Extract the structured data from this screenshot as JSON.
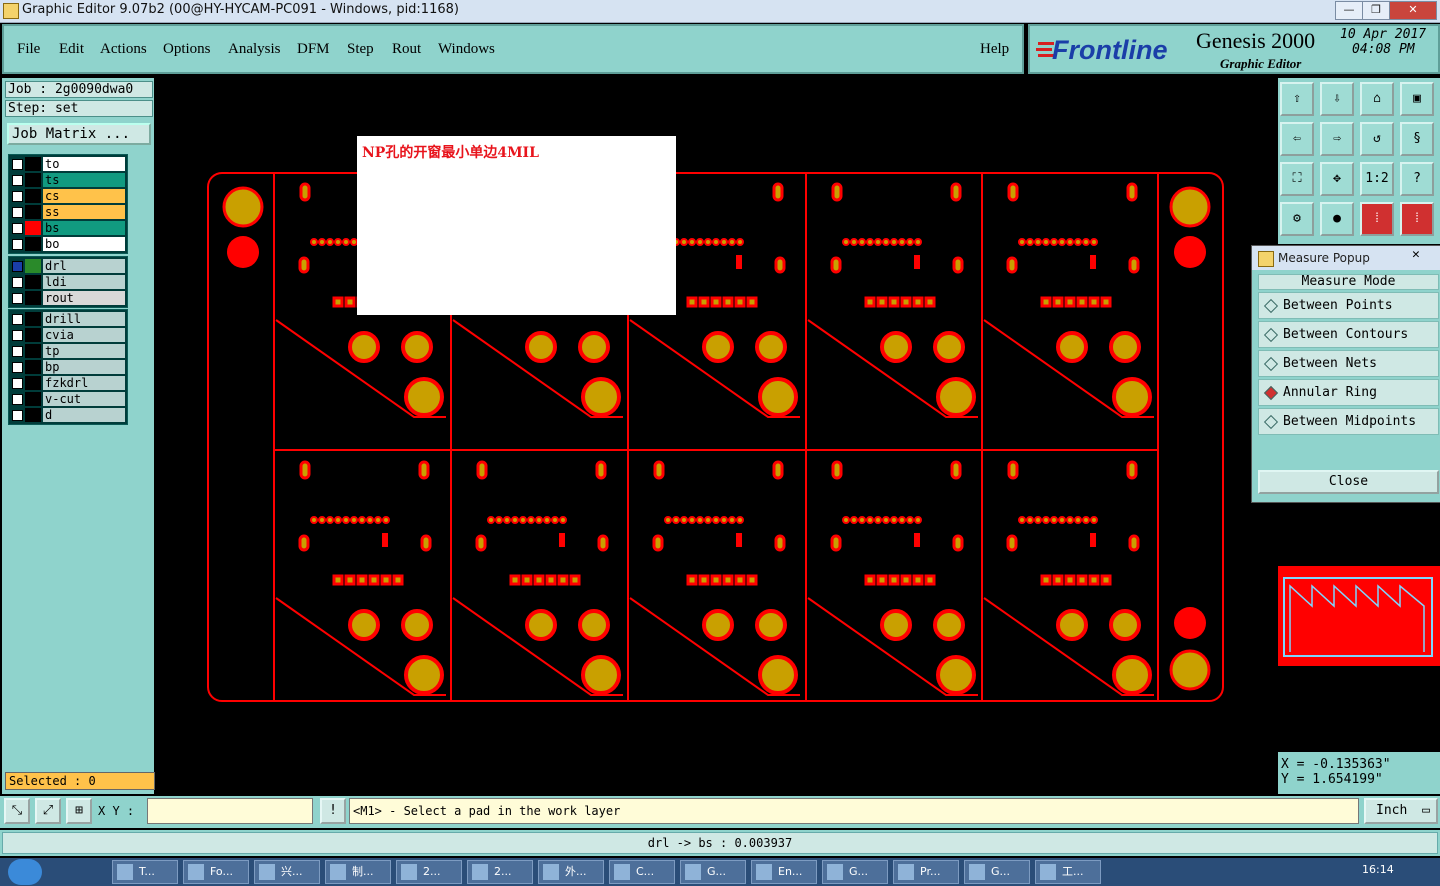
{
  "window": {
    "title": "Graphic Editor 9.07b2 (00@HY-HYCAM-PC091 - Windows, pid:1168)",
    "min": "—",
    "max": "❐",
    "close": "✕"
  },
  "menu": {
    "items": [
      "File",
      "Edit",
      "Actions",
      "Options",
      "Analysis",
      "DFM",
      "Step",
      "Rout",
      "Windows"
    ],
    "help": "Help"
  },
  "brand": {
    "logo": "Frontline",
    "product": "Genesis 2000",
    "subtitle": "Graphic Editor",
    "date": "10 Apr 2017",
    "time": "04:08 PM"
  },
  "job": {
    "job": "Job : 2g0090dwa0",
    "step": "Step: set",
    "matrix": "Job Matrix ..."
  },
  "layers": {
    "group1": [
      {
        "name": "to",
        "color": "#ffffff",
        "swatch": "#000000"
      },
      {
        "name": "ts",
        "color": "#119a80",
        "swatch": "#000000"
      },
      {
        "name": "cs",
        "color": "#ffc24a",
        "swatch": "#000000"
      },
      {
        "name": "ss",
        "color": "#ffc24a",
        "swatch": "#000000"
      },
      {
        "name": "bs",
        "color": "#119a80",
        "swatch": "#ff0000"
      },
      {
        "name": "bo",
        "color": "#ffffff",
        "swatch": "#000000"
      }
    ],
    "group2": [
      {
        "name": "drl",
        "color": "#b8d2d0",
        "swatch": "#2a8a2a"
      },
      {
        "name": "ldi",
        "color": "#b8d2d0",
        "swatch": "#000000"
      },
      {
        "name": "rout",
        "color": "#d8d8d8",
        "swatch": "#000000"
      }
    ],
    "group3": [
      {
        "name": "drill",
        "color": "#b8d2d0",
        "swatch": "#000000"
      },
      {
        "name": "cvia",
        "color": "#b8d2d0",
        "swatch": "#000000"
      },
      {
        "name": "tp",
        "color": "#b8d2d0",
        "swatch": "#000000"
      },
      {
        "name": "bp",
        "color": "#b8d2d0",
        "swatch": "#000000"
      },
      {
        "name": "fzkdrl",
        "color": "#b8d2d0",
        "swatch": "#000000"
      },
      {
        "name": "v-cut",
        "color": "#b8d2d0",
        "swatch": "#000000"
      },
      {
        "name": "d",
        "color": "#b8d2d0",
        "swatch": "#000000"
      }
    ]
  },
  "selected": "Selected : 0",
  "canvas": {
    "note": "NP孔的开窗最小单边4MIL"
  },
  "measure": {
    "title": "Measure Popup",
    "mode_label": "Measure Mode",
    "options": [
      "Between Points",
      "Between Contours",
      "Between Nets",
      "Annular Ring",
      "Between Midpoints"
    ],
    "active_option": "Annular Ring",
    "close": "Close"
  },
  "coords": {
    "x": "X = -0.135363\"",
    "y": "Y =  1.654199\""
  },
  "bottom": {
    "xy_label": "X Y :",
    "xy_value": "",
    "prompt": "<M1> - Select a pad in the work layer",
    "units": "Inch"
  },
  "status": "drl -> bs : 0.003937",
  "taskbar": {
    "items": [
      "T...",
      "Fo...",
      "兴...",
      "制...",
      "2...",
      "2...",
      "外...",
      "C...",
      "G...",
      "En...",
      "G...",
      "Pr...",
      "G...",
      "工..."
    ],
    "clock": "16:14"
  }
}
